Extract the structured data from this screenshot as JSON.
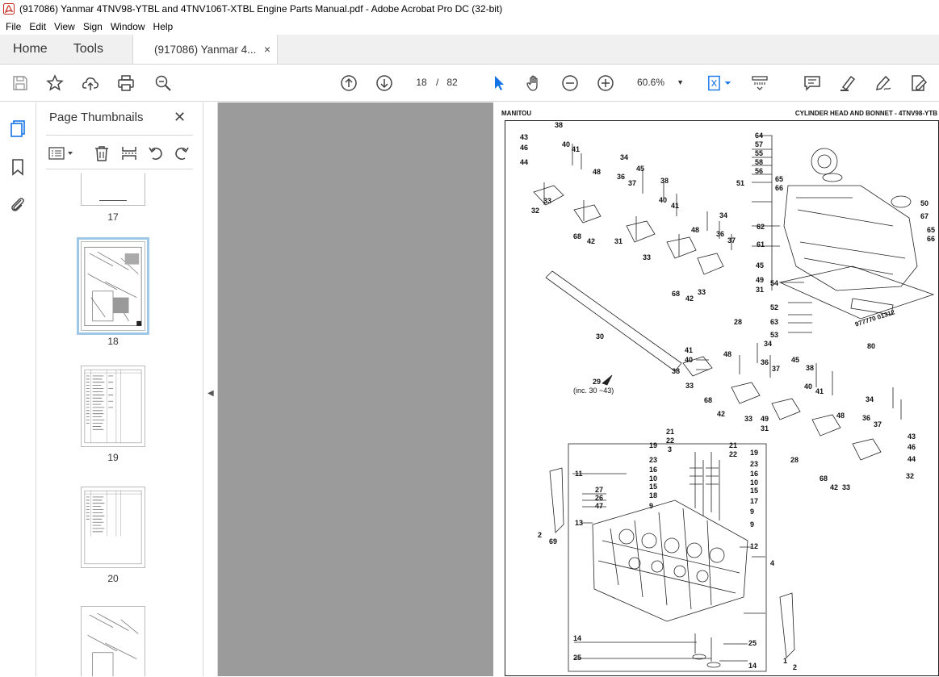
{
  "window": {
    "title": "(917086) Yanmar 4TNV98-YTBL and 4TNV106T-XTBL Engine Parts Manual.pdf - Adobe Acrobat Pro DC (32-bit)"
  },
  "menu": [
    "File",
    "Edit",
    "View",
    "Sign",
    "Window",
    "Help"
  ],
  "tabs": {
    "home": "Home",
    "tools": "Tools",
    "document": "(917086) Yanmar 4...",
    "close": "×"
  },
  "toolbar": {
    "current_page": "18",
    "page_separator": "/",
    "total_pages": "82",
    "zoom": "60.6%",
    "icons": [
      "save-icon",
      "bookmark-star-icon",
      "upload-icon",
      "print-icon",
      "search-zoom-icon",
      "page-up-icon",
      "page-down-icon",
      "select-cursor-icon",
      "hand-icon",
      "zoom-out-icon",
      "zoom-in-icon",
      "fit-page-icon",
      "scroll-mode-icon",
      "comment-icon",
      "highlight-icon",
      "sign-icon",
      "edit-pdf-icon"
    ]
  },
  "sidebar": {
    "header": "Page Thumbnails",
    "close": "✕",
    "thumbnails": [
      {
        "label": "17"
      },
      {
        "label": "18",
        "selected": true
      },
      {
        "label": "19"
      },
      {
        "label": "20"
      }
    ]
  },
  "page": {
    "header_left": "MANITOU",
    "header_right": "CYLINDER HEAD AND BONNET - 4TNV98-YTB",
    "callout_29": "29",
    "callout_29_note": "(inc. 30 ~43)",
    "labels": [
      "38",
      "43",
      "46",
      "44",
      "40",
      "41",
      "48",
      "32",
      "33",
      "68",
      "42",
      "34",
      "36",
      "37",
      "45",
      "38",
      "40",
      "41",
      "48",
      "31",
      "33",
      "64",
      "57",
      "55",
      "58",
      "56",
      "51",
      "65",
      "66",
      "50",
      "67",
      "62",
      "61",
      "65",
      "66",
      "34",
      "36",
      "37",
      "45",
      "49",
      "31",
      "68",
      "42",
      "33",
      "28",
      "54",
      "52",
      "63",
      "53",
      "30",
      "80",
      "41",
      "40",
      "48",
      "38",
      "33",
      "34",
      "36",
      "37",
      "45",
      "38",
      "40",
      "41",
      "48",
      "68",
      "42",
      "33",
      "49",
      "31",
      "34",
      "36",
      "37",
      "43",
      "46",
      "44",
      "32",
      "21",
      "22",
      "19",
      "3",
      "23",
      "16",
      "10",
      "15",
      "18",
      "9",
      "21",
      "22",
      "19",
      "23",
      "16",
      "10",
      "15",
      "17",
      "9",
      "9",
      "11",
      "27",
      "26",
      "47",
      "13",
      "2",
      "69",
      "12",
      "4",
      "28",
      "68",
      "42",
      "33",
      "14",
      "25",
      "25",
      "14",
      "1",
      "2"
    ]
  },
  "colors": {
    "accent": "#1473e6",
    "canvas": "#9b9b9b",
    "selection": "#9fc8e8"
  }
}
